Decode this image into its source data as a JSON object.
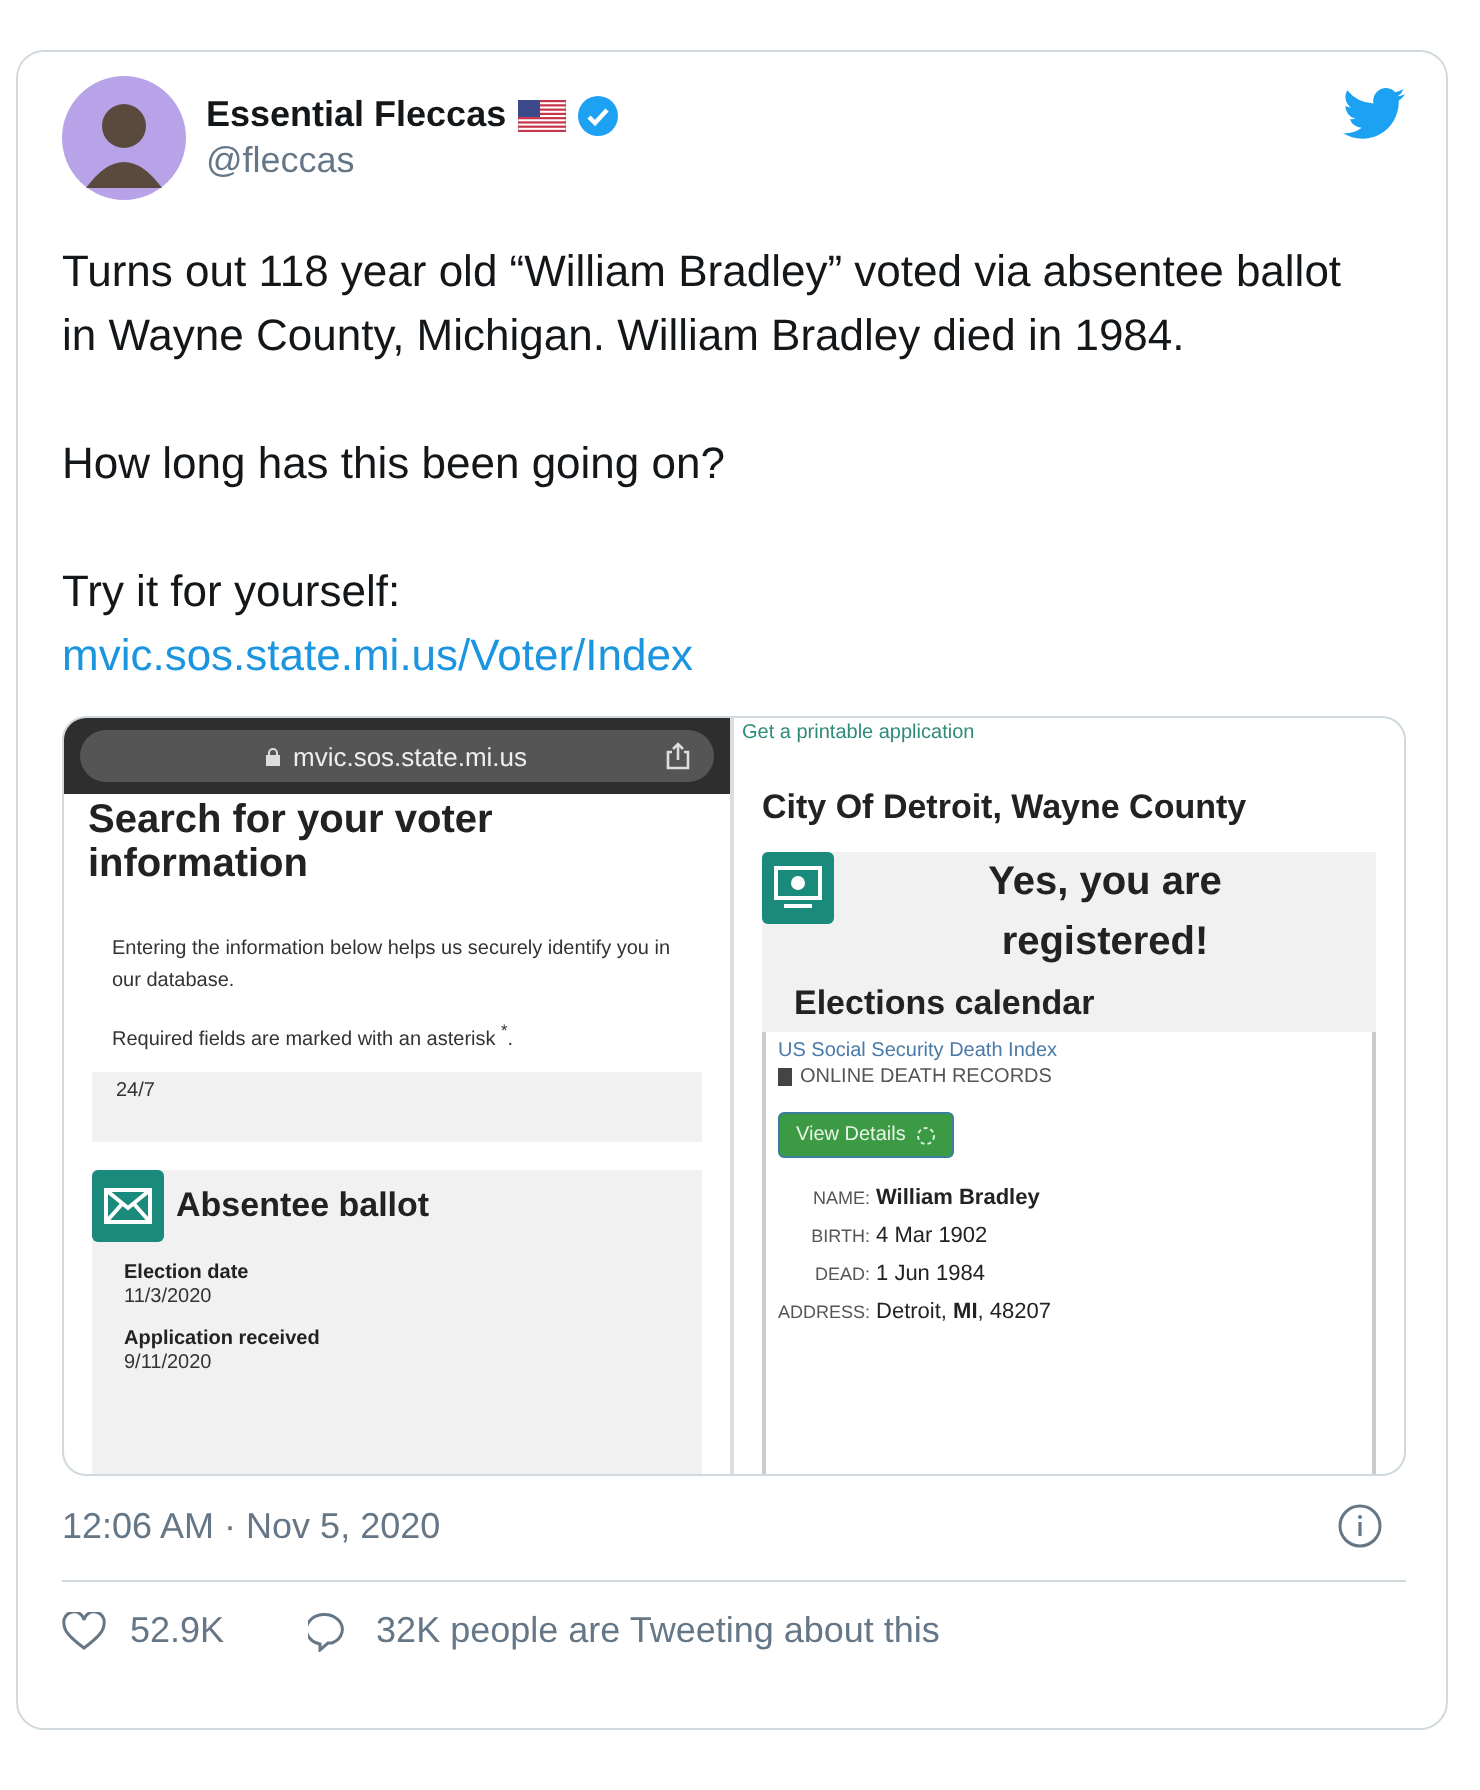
{
  "author": {
    "name": "Essential Fleccas",
    "handle": "@fleccas",
    "verified": true
  },
  "paragraphs": [
    "Turns out 118 year old “William Bradley” voted via absentee ballot in Wayne County, Michigan. William Bradley died in 1984.",
    "How long has this been going on?",
    "Try it for yourself:"
  ],
  "link": "mvic.sos.state.mi.us/Voter/Index",
  "media": {
    "browser_url": "mvic.sos.state.mi.us",
    "search_title": "Search for your voter information",
    "intro": "Entering the information below helps us securely identify you in our database.",
    "required_note": "Required fields are marked with an asterisk $^{*}$.",
    "hours": "24/7",
    "absentee": {
      "title": "Absentee ballot",
      "fields": [
        {
          "label": "Election date",
          "value": "11/3/2020"
        },
        {
          "label": "Application received",
          "value": "9/11/2020"
        }
      ]
    },
    "printable_link": "Get a printable application",
    "city_title": "City Of Detroit, Wayne County",
    "registered_message": "Yes, you are registered!",
    "calendar_heading": "Elections calendar",
    "death_index": {
      "title": "US Social Security Death Index",
      "subtitle": "ONLINE DEATH RECORDS",
      "button": "View Details",
      "fields": [
        {
          "label": "NAME:",
          "value": "**William Bradley**"
        },
        {
          "label": "BIRTH:",
          "value": "4 Mar 1902"
        },
        {
          "label": "DEAD:",
          "value": "1 Jun 1984"
        },
        {
          "label": "ADDRESS:",
          "value": "Detroit, **MI**, 48207"
        }
      ]
    }
  },
  "timestamp": "12:06 AM · Nov 5, 2020",
  "likes": "52.9K",
  "conversation": "32K people are Tweeting about this"
}
